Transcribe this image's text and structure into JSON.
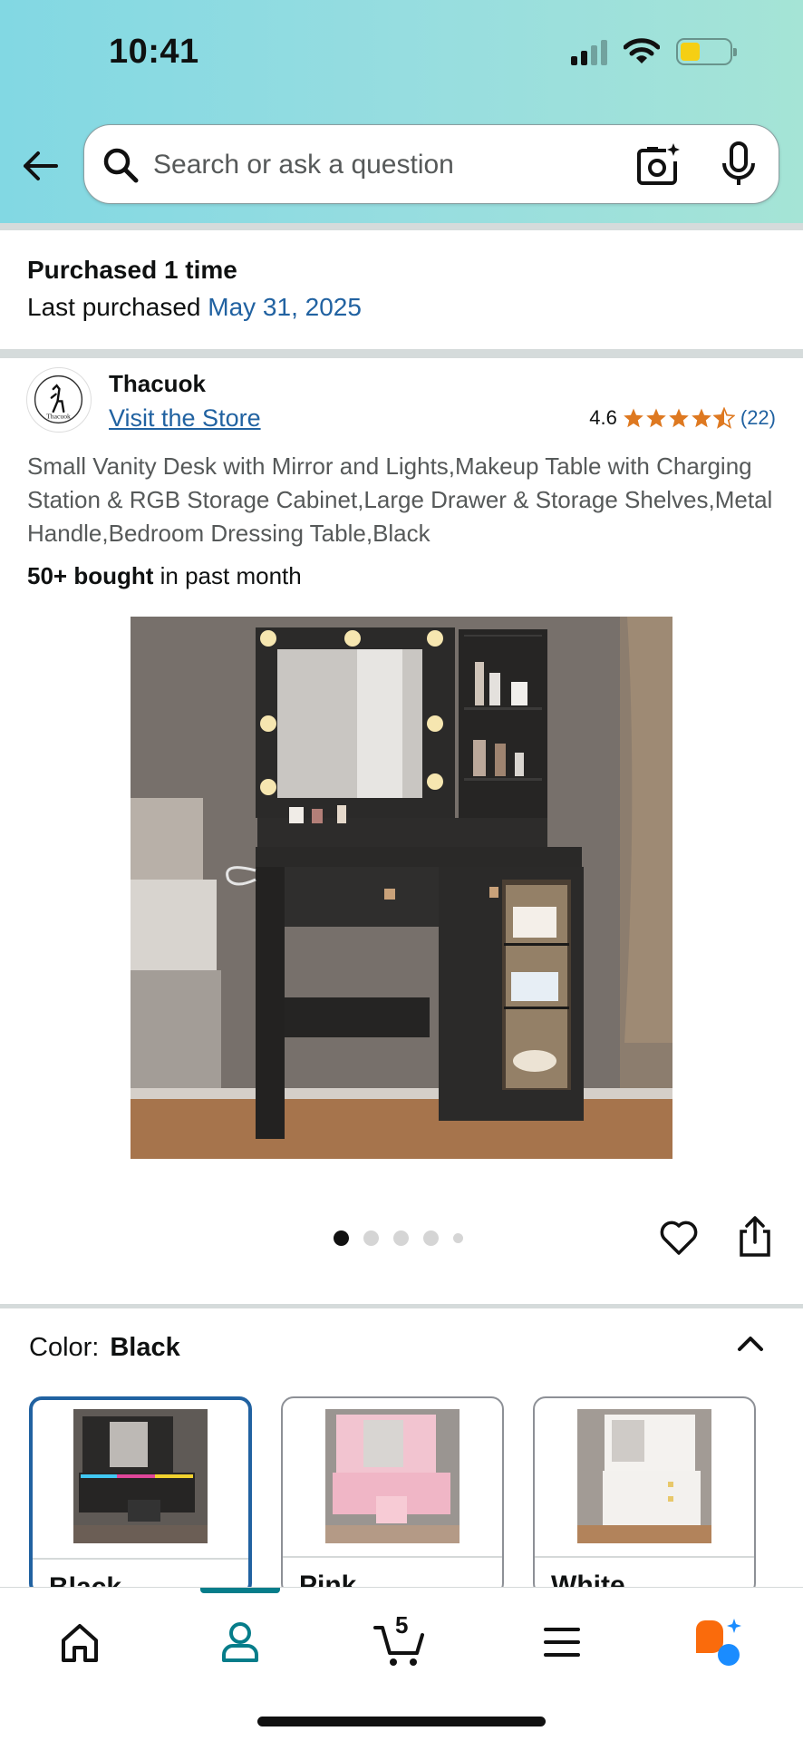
{
  "status_bar": {
    "time": "10:41"
  },
  "search": {
    "placeholder": "Search or ask a question"
  },
  "purchase": {
    "purchased_text": "Purchased 1 time",
    "last_purchased_label": "Last purchased",
    "last_purchased_date": "May 31, 2025"
  },
  "brand": {
    "name": "Thacuok",
    "visit_store": "Visit the Store",
    "logo_text": "Thacuok"
  },
  "rating": {
    "value": "4.6",
    "stars": 4.5,
    "count": "(22)"
  },
  "product": {
    "title": "Small Vanity Desk with Mirror and Lights,Makeup Table with Charging Station & RGB Storage Cabinet,Large Drawer & Storage Shelves,Metal Handle,Bedroom Dressing Table,Black",
    "bought_bold": "50+ bought",
    "bought_rest": "in past month",
    "image_count": 5,
    "active_image": 1
  },
  "color": {
    "label": "Color:",
    "selected": "Black",
    "options": [
      {
        "label": "Black",
        "selected": true
      },
      {
        "label": "Pink",
        "selected": false
      },
      {
        "label": "White",
        "selected": false
      }
    ]
  },
  "nav": {
    "cart_count": "5",
    "active": "account"
  },
  "colors": {
    "link": "#2162a1",
    "accent_teal": "#067d8a",
    "star": "#de7921",
    "header_gradient": [
      "#82d8e3",
      "#a5e4d6"
    ]
  },
  "icons": [
    "back-arrow-icon",
    "search-icon",
    "camera-icon",
    "mic-icon",
    "heart-icon",
    "share-icon",
    "chevron-up-icon",
    "home-icon",
    "account-icon",
    "cart-icon",
    "menu-icon",
    "rufus-icon"
  ]
}
